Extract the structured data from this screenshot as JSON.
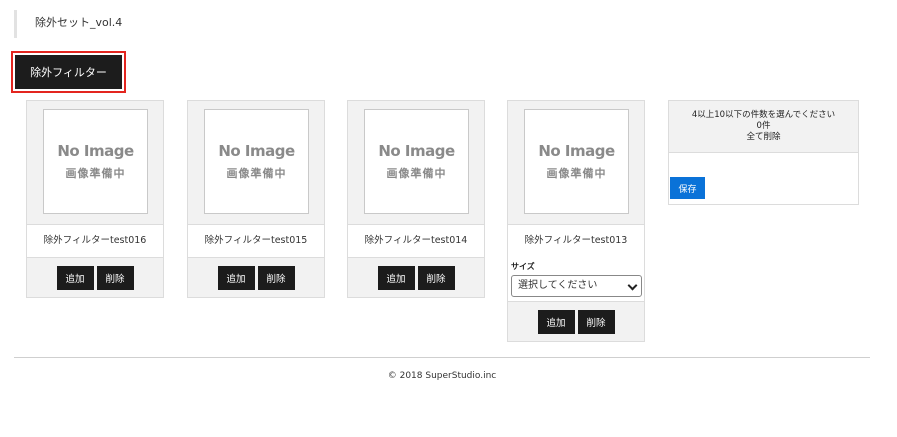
{
  "page": {
    "title": "除外セット_vol.4"
  },
  "filter_button": {
    "label": "除外フィルター"
  },
  "placeholder_image": {
    "title": "No Image",
    "subtitle": "画像準備中"
  },
  "cards": [
    {
      "name": "除外フィルターtest016",
      "add_label": "追加",
      "delete_label": "削除"
    },
    {
      "name": "除外フィルターtest015",
      "add_label": "追加",
      "delete_label": "削除"
    },
    {
      "name": "除外フィルターtest014",
      "add_label": "追加",
      "delete_label": "削除"
    },
    {
      "name": "除外フィルターtest013",
      "add_label": "追加",
      "delete_label": "削除",
      "size_label": "サイズ",
      "size_value": "選択してください"
    }
  ],
  "selection_panel": {
    "instruction": "4以上10以下の件数を選んでください",
    "count": "0件",
    "delete_all": "全て削除",
    "save_label": "保存"
  },
  "footer": {
    "copyright": "© 2018 SuperStudio.inc"
  }
}
